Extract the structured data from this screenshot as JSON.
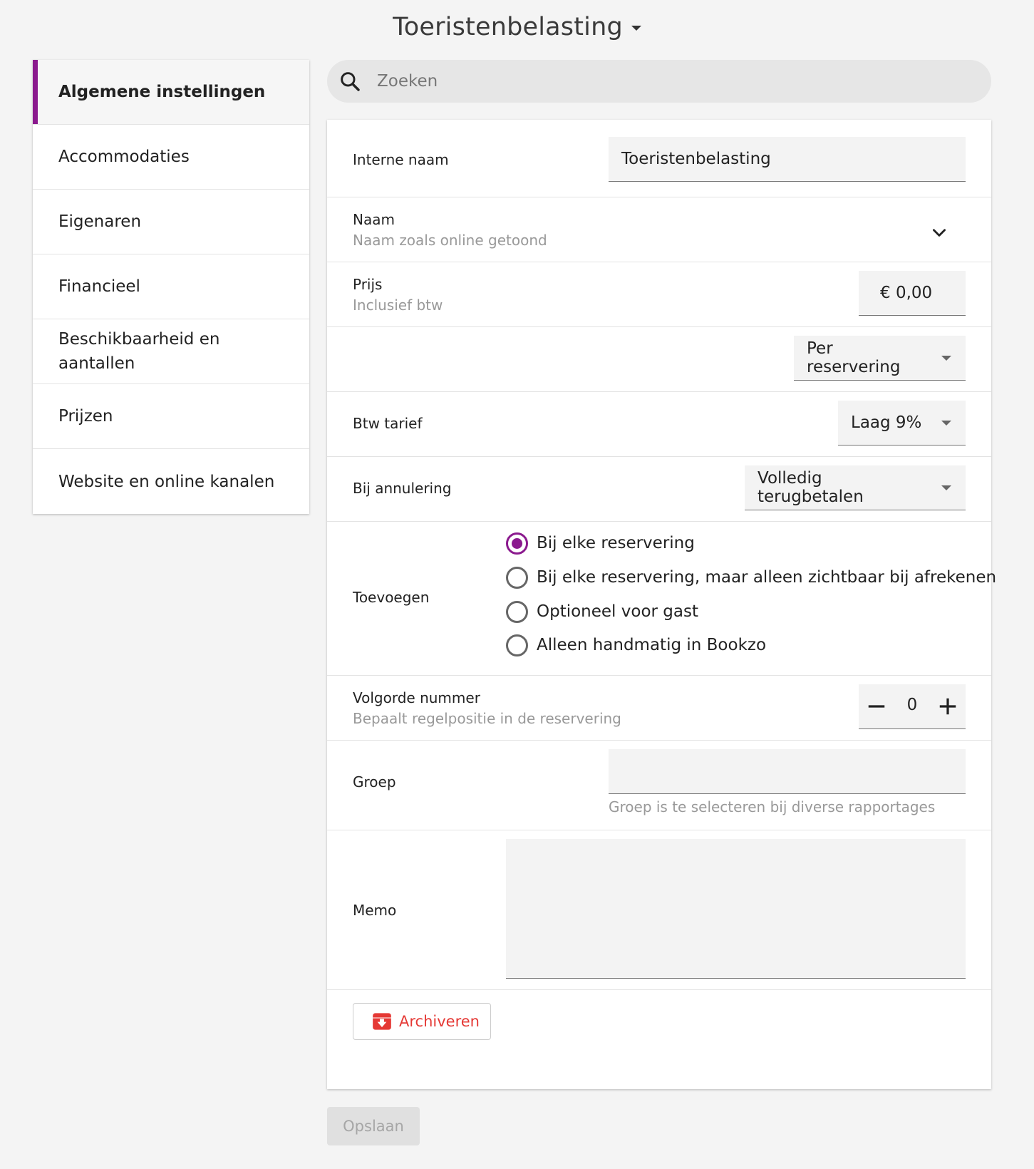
{
  "header": {
    "title": "Toeristenbelasting"
  },
  "sidebar": {
    "items": [
      {
        "label": "Algemene instellingen",
        "active": true
      },
      {
        "label": "Accommodaties"
      },
      {
        "label": "Eigenaren"
      },
      {
        "label": "Financieel"
      },
      {
        "label": "Beschikbaarheid en aantallen"
      },
      {
        "label": "Prijzen"
      },
      {
        "label": "Website en online kanalen"
      }
    ]
  },
  "search": {
    "placeholder": "Zoeken",
    "icon": "search-icon"
  },
  "form": {
    "internal_name": {
      "label": "Interne naam",
      "value": "Toeristenbelasting"
    },
    "name": {
      "label": "Naam",
      "sub": "Naam zoals online getoond",
      "icon": "chevron-down-icon"
    },
    "price": {
      "label": "Prijs",
      "sub": "Inclusief btw",
      "value": "€ 0,00"
    },
    "per": {
      "value": "Per reservering"
    },
    "vat": {
      "label": "Btw tarief",
      "value": "Laag 9%"
    },
    "cancellation": {
      "label": "Bij annulering",
      "value": "Volledig terugbetalen"
    },
    "add": {
      "label": "Toevoegen",
      "options": [
        {
          "label": "Bij elke reservering",
          "checked": true
        },
        {
          "label": "Bij elke reservering, maar alleen zichtbaar bij afrekenen",
          "checked": false
        },
        {
          "label": "Optioneel voor gast",
          "checked": false
        },
        {
          "label": "Alleen handmatig in Bookzo",
          "checked": false
        }
      ]
    },
    "order": {
      "label": "Volgorde nummer",
      "sub": "Bepaalt regelpositie in de reservering",
      "value": "0"
    },
    "group": {
      "label": "Groep",
      "value": "",
      "hint": "Groep is te selecteren bij diverse rapportages"
    },
    "memo": {
      "label": "Memo",
      "value": ""
    },
    "archive_label": "Archiveren"
  },
  "save_label": "Opslaan",
  "colors": {
    "accent": "#8b1a8e",
    "danger": "#e53935",
    "background": "#f4f4f4"
  }
}
